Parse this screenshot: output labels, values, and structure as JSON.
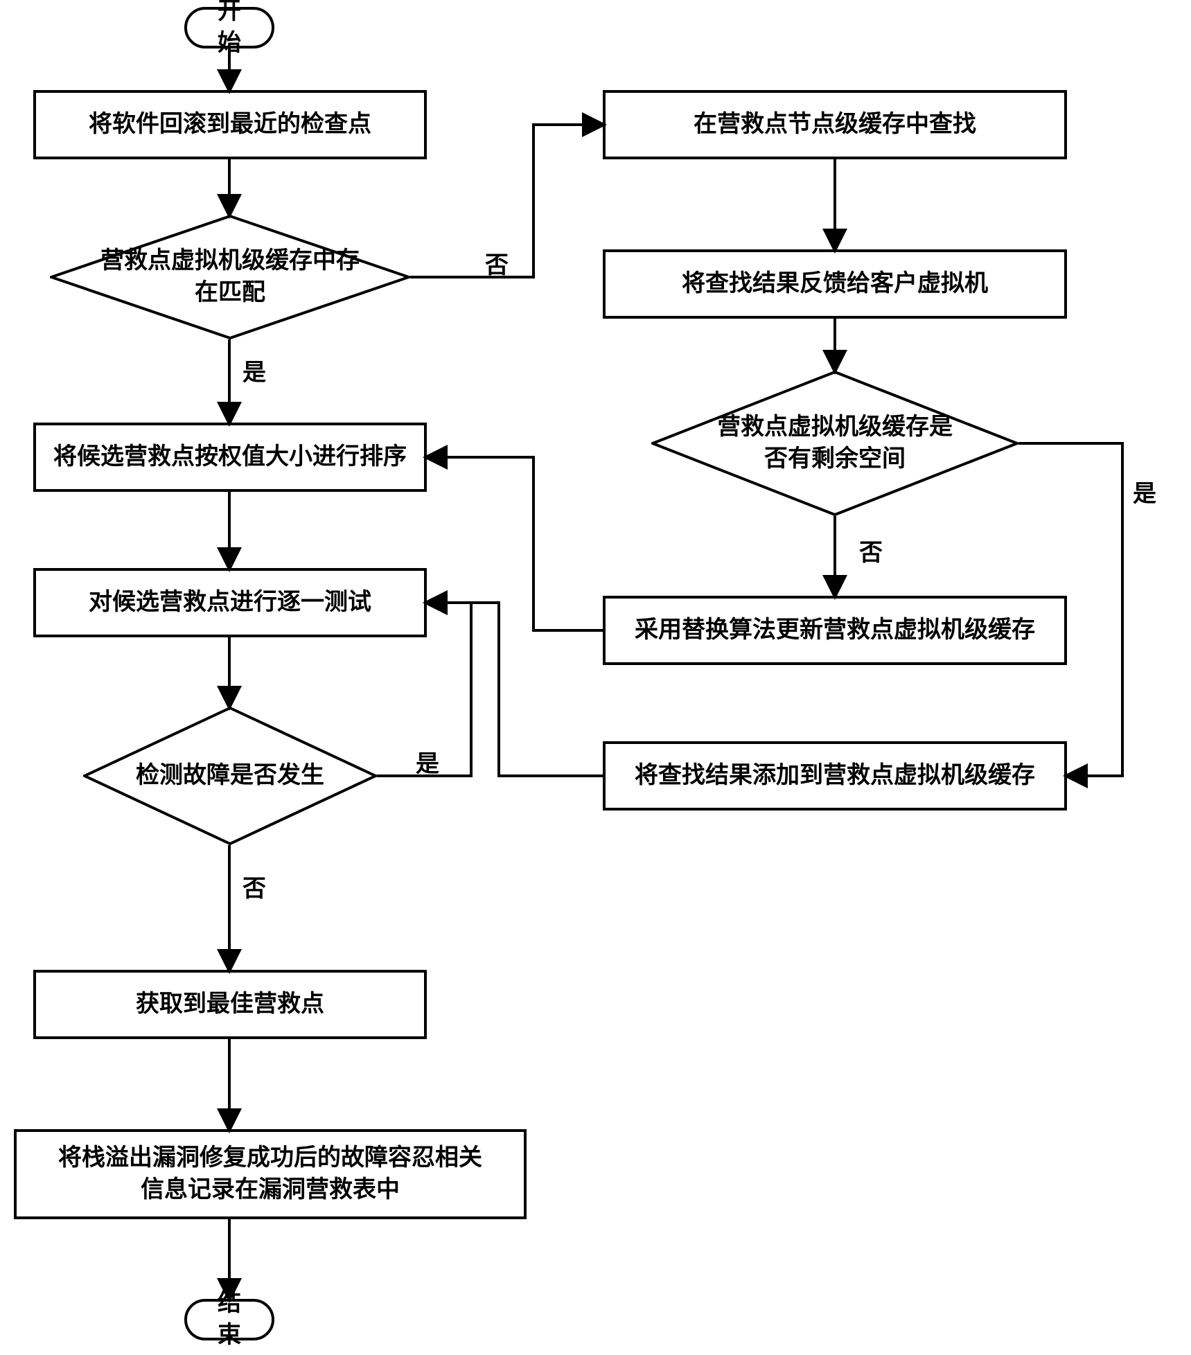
{
  "chart_data": {
    "type": "flowchart",
    "nodes": [
      {
        "id": "start",
        "kind": "terminal",
        "text": "开始"
      },
      {
        "id": "n1",
        "kind": "process",
        "text": "将软件回滚到最近的检查点"
      },
      {
        "id": "d1",
        "kind": "decision",
        "text": "营救点虚拟机级缓存中存在匹配"
      },
      {
        "id": "n2",
        "kind": "process",
        "text": "将候选营救点按权值大小进行排序"
      },
      {
        "id": "n3",
        "kind": "process",
        "text": "对候选营救点进行逐一测试"
      },
      {
        "id": "d2",
        "kind": "decision",
        "text": "检测故障是否发生"
      },
      {
        "id": "n4",
        "kind": "process",
        "text": "获取到最佳营救点"
      },
      {
        "id": "n5",
        "kind": "process",
        "text": "将栈溢出漏洞修复成功后的故障容忍相关信息记录在漏洞营救表中"
      },
      {
        "id": "end",
        "kind": "terminal",
        "text": "结束"
      },
      {
        "id": "r1",
        "kind": "process",
        "text": "在营救点节点级缓存中查找"
      },
      {
        "id": "r2",
        "kind": "process",
        "text": "将查找结果反馈给客户虚拟机"
      },
      {
        "id": "dR",
        "kind": "decision",
        "text": "营救点虚拟机级缓存是否有剩余空间"
      },
      {
        "id": "r3",
        "kind": "process",
        "text": "采用替换算法更新营救点虚拟机级缓存"
      },
      {
        "id": "r4",
        "kind": "process",
        "text": "将查找结果添加到营救点虚拟机级缓存"
      }
    ],
    "edges": [
      {
        "from": "start",
        "to": "n1"
      },
      {
        "from": "n1",
        "to": "d1"
      },
      {
        "from": "d1",
        "to": "n2",
        "label": "是"
      },
      {
        "from": "d1",
        "to": "r1",
        "label": "否"
      },
      {
        "from": "n2",
        "to": "n3"
      },
      {
        "from": "n3",
        "to": "d2"
      },
      {
        "from": "d2",
        "to": "n4",
        "label": "否"
      },
      {
        "from": "d2",
        "to": "n3",
        "label": "是"
      },
      {
        "from": "n4",
        "to": "n5"
      },
      {
        "from": "n5",
        "to": "end"
      },
      {
        "from": "r1",
        "to": "r2"
      },
      {
        "from": "r2",
        "to": "dR"
      },
      {
        "from": "dR",
        "to": "r3",
        "label": "否"
      },
      {
        "from": "dR",
        "to": "r4",
        "label": "是"
      },
      {
        "from": "r3",
        "to": "n2"
      },
      {
        "from": "r4",
        "to": "n3"
      }
    ]
  },
  "labels": {
    "yes": "是",
    "no": "否"
  },
  "text": {
    "start": "开始",
    "end": "结束",
    "n1": "将软件回滚到最近的检查点",
    "n2": "将候选营救点按权值大小进行排序",
    "n3": "对候选营救点进行逐一测试",
    "n4": "获取到最佳营救点",
    "n5": "将栈溢出漏洞修复成功后的故障容忍相关\n信息记录在漏洞营救表中",
    "d1": "营救点虚拟机级缓存中存在匹配",
    "d2": "检测故障是否发生",
    "r1": "在营救点节点级缓存中查找",
    "r2": "将查找结果反馈给客户虚拟机",
    "dR": "营救点虚拟机级缓存是\n否有剩余空间",
    "r3": "采用替换算法更新营救点虚拟机级缓存",
    "r4": "将查找结果添加到营救点虚拟机级缓存"
  }
}
